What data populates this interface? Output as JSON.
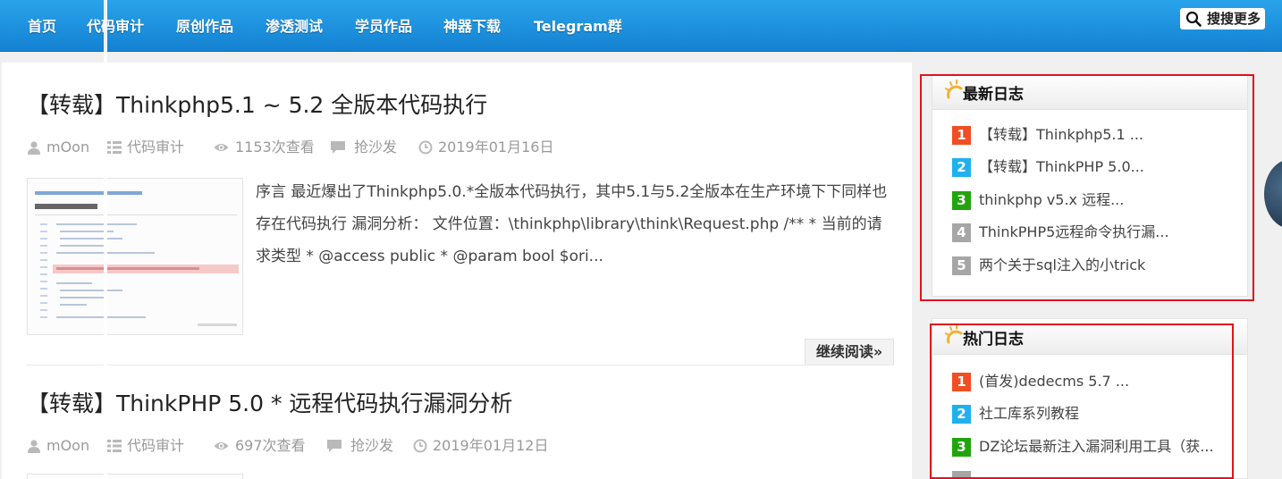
{
  "nav": {
    "items": [
      "首页",
      "代码审计",
      "原创作品",
      "渗透测试",
      "学员作品",
      "神器下载",
      "Telegram群"
    ],
    "search_label": "搜搜更多"
  },
  "posts": [
    {
      "title": "【转载】Thinkphp5.1 ~ 5.2 全版本代码执行",
      "author": "mOon",
      "category": "代码审计",
      "views": "1153次查看",
      "comment": "抢沙发",
      "date": "2019年01月16日",
      "excerpt": "序言 最近爆出了Thinkphp5.0.*全版本代码执行，其中5.1与5.2全版本在生产环境下下同样也存在代码执行 漏洞分析： 文件位置：\\thinkphp\\library\\think\\Request.php /** * 当前的请求类型 * @access public * @param bool $ori...",
      "read_more": "继续阅读»"
    },
    {
      "title": "【转载】ThinkPHP 5.0 * 远程代码执行漏洞分析",
      "author": "mOon",
      "category": "代码审计",
      "views": "697次查看",
      "comment": "抢沙发",
      "date": "2019年01月12日"
    }
  ],
  "sidebar": {
    "latest": {
      "title": "最新日志",
      "items": [
        {
          "num": "1",
          "text": "【转载】Thinkphp5.1 ..."
        },
        {
          "num": "2",
          "text": "【转载】ThinkPHP 5.0..."
        },
        {
          "num": "3",
          "text": "thinkphp v5.x 远程..."
        },
        {
          "num": "4",
          "text": "ThinkPHP5远程命令执行漏..."
        },
        {
          "num": "5",
          "text": "两个关于sql注入的小trick"
        }
      ]
    },
    "hot": {
      "title": "热门日志",
      "items": [
        {
          "num": "1",
          "text": "(首发)dedecms 5.7 ..."
        },
        {
          "num": "2",
          "text": "社工库系列教程"
        },
        {
          "num": "3",
          "text": "DZ论坛最新注入漏洞利用工具（获..."
        }
      ]
    }
  },
  "colors": {
    "nav_top": "#2aa3ea",
    "nav_bottom": "#1482d2",
    "rank1": "#f04e23",
    "rank2": "#1fb1ee",
    "rank3": "#22a50c",
    "rank_other": "#a6a6a6",
    "highlight": "#e0141e"
  }
}
